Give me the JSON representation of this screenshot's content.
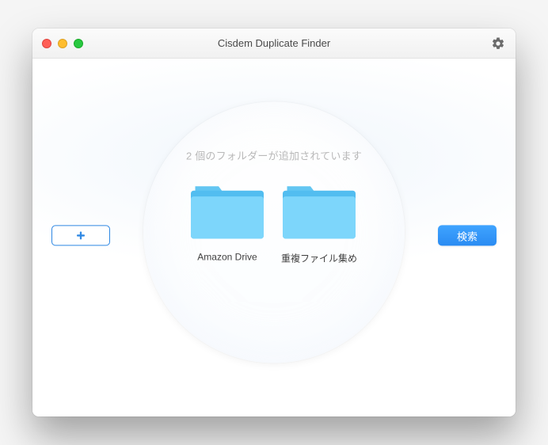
{
  "window": {
    "title": "Cisdem Duplicate Finder"
  },
  "status": {
    "folder_count_text": "2 個のフォルダーが追加されています"
  },
  "folders": [
    {
      "name": "Amazon Drive"
    },
    {
      "name": "重複ファイル集め"
    }
  ],
  "buttons": {
    "add_label": "+",
    "search_label": "検索"
  },
  "icons": {
    "settings": "gear-icon",
    "add": "plus-icon",
    "folder": "folder-icon"
  }
}
